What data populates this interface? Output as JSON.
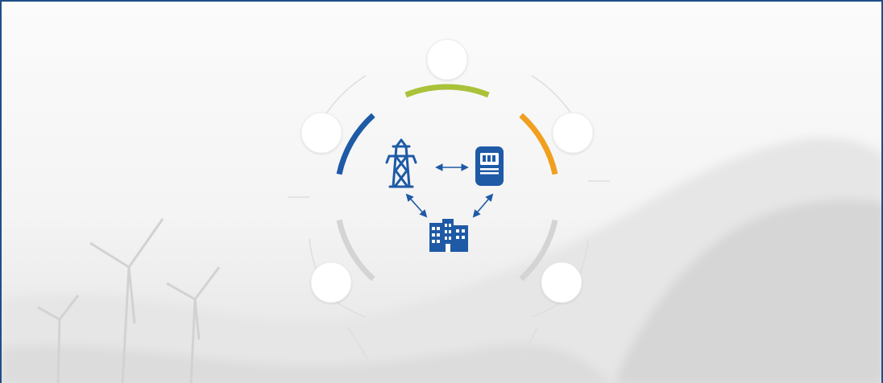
{
  "diagram": {
    "labels": [],
    "nodes": [
      {
        "id": "power-tower",
        "icon": "transmission-tower-icon"
      },
      {
        "id": "smart-meter",
        "icon": "meter-icon"
      },
      {
        "id": "building",
        "icon": "building-icon"
      }
    ],
    "links": [
      {
        "from": "power-tower",
        "to": "smart-meter",
        "style": "bidirectional"
      },
      {
        "from": "power-tower",
        "to": "building",
        "style": "bidirectional"
      },
      {
        "from": "smart-meter",
        "to": "building",
        "style": "bidirectional"
      }
    ],
    "ring_segments": [
      {
        "position": "top",
        "color": "#a9c23a"
      },
      {
        "position": "upper-left",
        "color": "#1e5aa6"
      },
      {
        "position": "upper-right",
        "color": "#f0a01e"
      },
      {
        "position": "lower-left",
        "color": "#d4d4d4"
      },
      {
        "position": "lower-right",
        "color": "#d4d4d4"
      }
    ],
    "colors": {
      "icon": "#1e5aa6",
      "frame_border": "#1f4e86",
      "connector_line": "#dedede",
      "node_circle": "#ffffff"
    }
  }
}
